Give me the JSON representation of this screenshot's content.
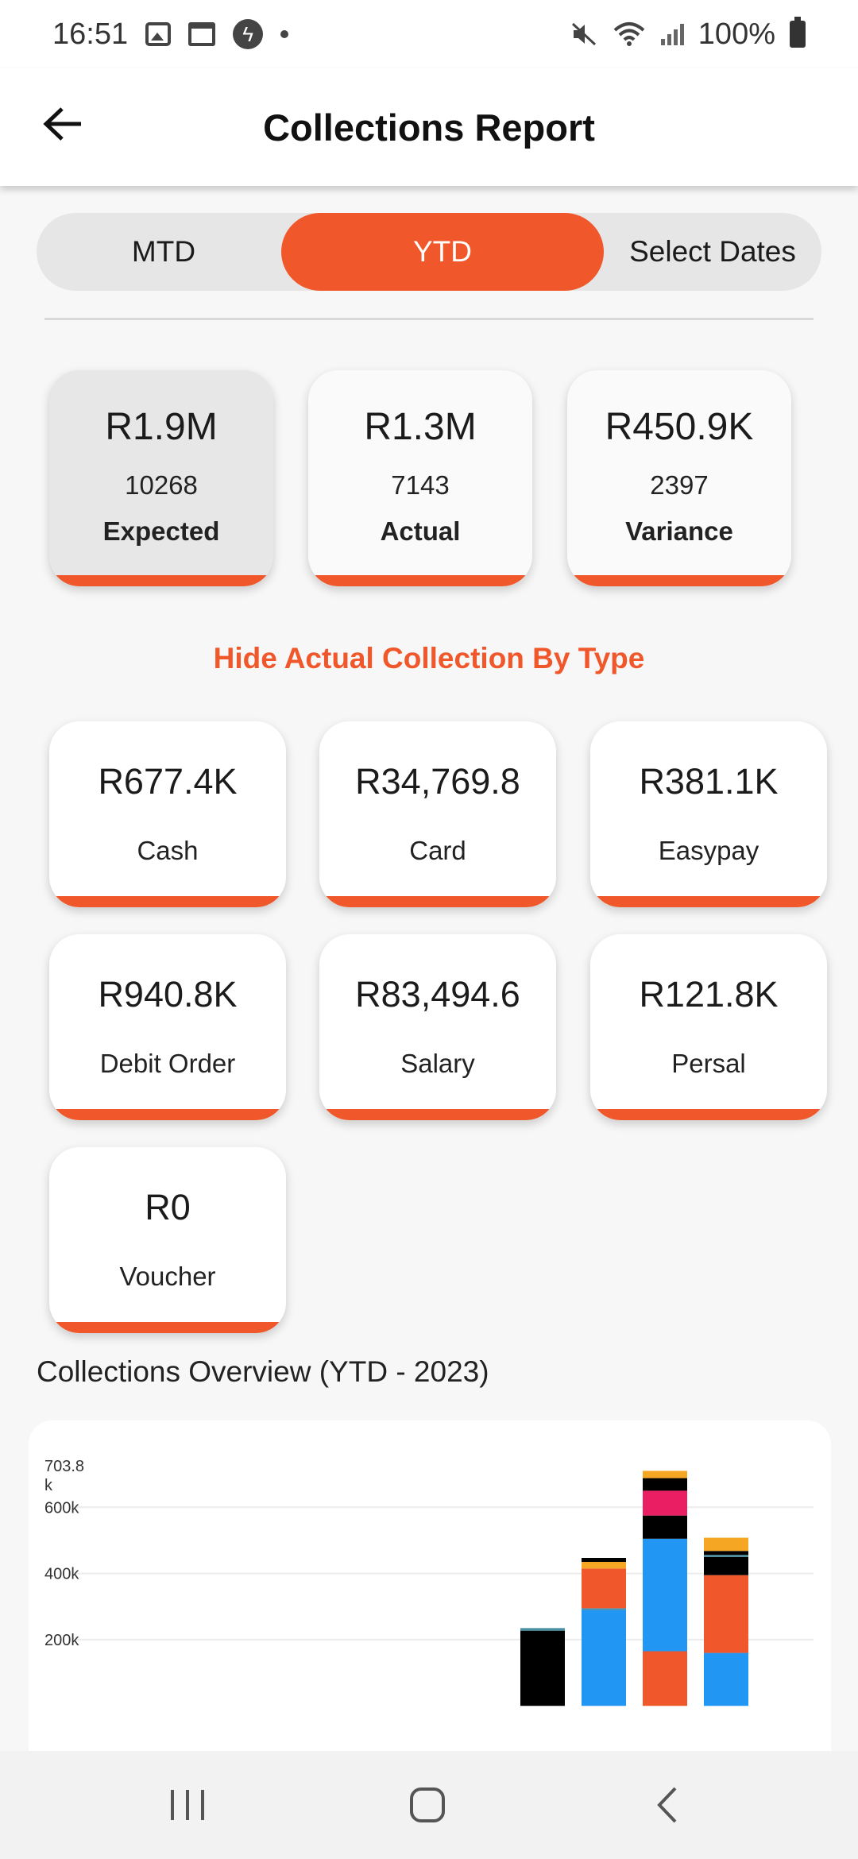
{
  "status_bar": {
    "time": "16:51",
    "battery": "100%"
  },
  "header": {
    "title": "Collections Report"
  },
  "period_tabs": [
    {
      "label": "MTD",
      "active": false
    },
    {
      "label": "YTD",
      "active": true
    },
    {
      "label": "Select Dates",
      "active": false
    }
  ],
  "summary": [
    {
      "value": "R1.9M",
      "count": "10268",
      "label": "Expected",
      "selected": true
    },
    {
      "value": "R1.3M",
      "count": "7143",
      "label": "Actual",
      "selected": false
    },
    {
      "value": "R450.9K",
      "count": "2397",
      "label": "Variance",
      "selected": false
    }
  ],
  "toggle_link": "Hide Actual Collection By Type",
  "collection_types": [
    {
      "value": "R677.4K",
      "label": "Cash"
    },
    {
      "value": "R34,769.8",
      "label": "Card"
    },
    {
      "value": "R381.1K",
      "label": "Easypay"
    },
    {
      "value": "R940.8K",
      "label": "Debit Order"
    },
    {
      "value": "R83,494.6",
      "label": "Salary"
    },
    {
      "value": "R121.8K",
      "label": "Persal"
    },
    {
      "value": "R0",
      "label": "Voucher"
    }
  ],
  "overview_title": "Collections Overview (YTD - 2023)",
  "colors": {
    "accent": "#f0572a",
    "blue": "#2196f3",
    "black": "#000000",
    "orange": "#f5a623",
    "pink": "#e91e63",
    "teal": "#4a90a4"
  },
  "chart_data": {
    "type": "bar",
    "stacked": true,
    "y_tick_labels": [
      "703.8\nk",
      "600k",
      "400k",
      "200k"
    ],
    "y_ticks": [
      703800,
      600000,
      400000,
      200000
    ],
    "grid": true,
    "bars": [
      {
        "segments": [
          {
            "color": "#000000",
            "value": 227000
          },
          {
            "color": "#4a90a4",
            "value": 8000
          }
        ]
      },
      {
        "segments": [
          {
            "color": "#2196f3",
            "value": 290000
          },
          {
            "color": "#4a90a4",
            "value": 5000
          },
          {
            "color": "#f0572a",
            "value": 120000
          },
          {
            "color": "#f5a623",
            "value": 20000
          },
          {
            "color": "#000000",
            "value": 12000
          }
        ]
      },
      {
        "segments": [
          {
            "color": "#f0572a",
            "value": 165000
          },
          {
            "color": "#2196f3",
            "value": 340000
          },
          {
            "color": "#000000",
            "value": 70000
          },
          {
            "color": "#e91e63",
            "value": 75000
          },
          {
            "color": "#000000",
            "value": 38000
          },
          {
            "color": "#f5a623",
            "value": 22000
          }
        ]
      },
      {
        "segments": [
          {
            "color": "#2196f3",
            "value": 160000
          },
          {
            "color": "#f0572a",
            "value": 235000
          },
          {
            "color": "#000000",
            "value": 55000
          },
          {
            "color": "#4a90a4",
            "value": 6000
          },
          {
            "color": "#000000",
            "value": 12000
          },
          {
            "color": "#f5a623",
            "value": 40000
          }
        ]
      }
    ]
  }
}
